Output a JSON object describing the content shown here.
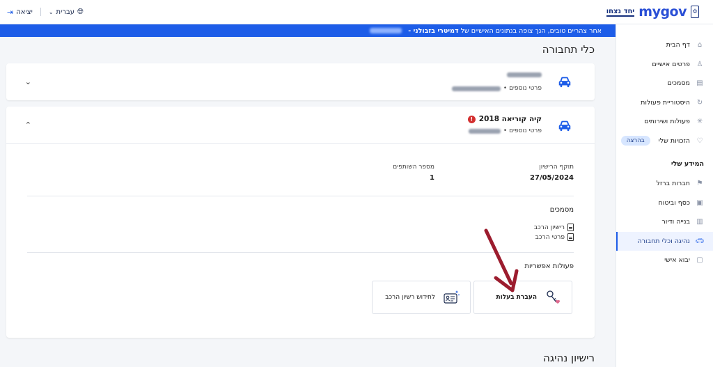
{
  "header": {
    "logo_text": "mygov",
    "logo_sub": "יחד נצחו",
    "logout_label": "יציאה",
    "language_label": "עברית"
  },
  "banner": {
    "greeting": "אחר צהריים טובים, הנך צופה בנתונים האישיים של",
    "user_name": "דמיטרי בזבולני -"
  },
  "sidebar": {
    "items": [
      {
        "label": "דף הבית",
        "icon": "home-icon"
      },
      {
        "label": "פרטים אישיים",
        "icon": "person-icon"
      },
      {
        "label": "מסמכים",
        "icon": "document-icon"
      },
      {
        "label": "היסטוריית פעולות",
        "icon": "history-icon"
      },
      {
        "label": "פעולות ושירותים",
        "icon": "sparkle-icon"
      },
      {
        "label": "הזכויות שלי",
        "icon": "heart-icon",
        "tag": "בהרצה"
      }
    ],
    "section_title": "המידע שלי",
    "info_items": [
      {
        "label": "חברות ברזל",
        "icon": "flag-icon"
      },
      {
        "label": "כסף וביטוח",
        "icon": "money-icon"
      },
      {
        "label": "בנייה ודיור",
        "icon": "building-icon"
      },
      {
        "label": "נהיגה וכלי תחבורה",
        "icon": "car-icon",
        "active": true
      },
      {
        "label": "יבוא אישי",
        "icon": "box-icon"
      }
    ]
  },
  "main": {
    "page_title": "כלי תחבורה",
    "vehicle1": {
      "sub_label": "פרטי נוספים •"
    },
    "vehicle2": {
      "name": "קיה קוריאה 2018",
      "sub_label": "פרטי נוספים •",
      "license_expiry_label": "תוקף הרישיון",
      "license_expiry_value": "27/05/2024",
      "partners_label": "מספר השותפים",
      "partners_value": "1",
      "documents_title": "מסמכים",
      "documents": [
        "רישיון הרכב",
        "פרטי הרכב"
      ],
      "actions_title": "פעולות אפשריות",
      "actions": [
        {
          "label": "העברת בעלות",
          "icon": "keys-icon"
        },
        {
          "label": "לחידוש רשיון הרכב",
          "icon": "license-card-icon"
        }
      ]
    },
    "bottom_title": "רישיון נהיגה"
  },
  "colors": {
    "brand_blue": "#1d5de8",
    "alert_red": "#d32f2f",
    "annotation_arrow": "#9c1c2e"
  }
}
